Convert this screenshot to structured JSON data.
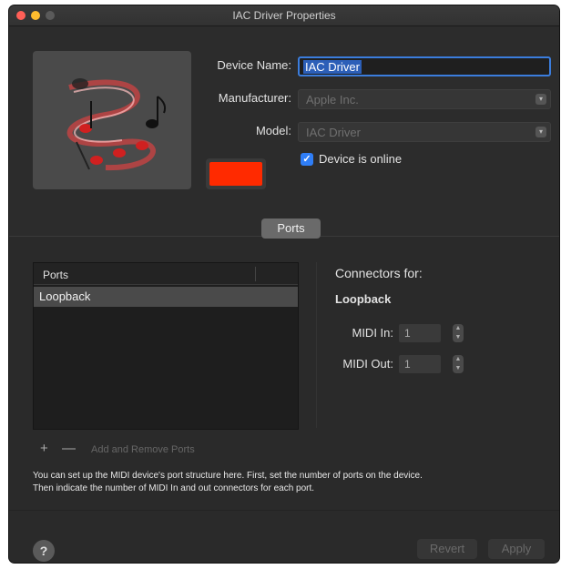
{
  "window": {
    "title": "IAC Driver Properties"
  },
  "device": {
    "name_label": "Device Name:",
    "name_value": "IAC Driver",
    "manufacturer_label": "Manufacturer:",
    "manufacturer_placeholder": "Apple Inc.",
    "model_label": "Model:",
    "model_placeholder": "IAC Driver",
    "online_label": "Device is online",
    "online_checked": true,
    "color": "#ff2a00",
    "icon": "music-notes-icon"
  },
  "tabs": {
    "ports_label": "Ports"
  },
  "ports": {
    "header": "Ports",
    "items": [
      {
        "label": "Loopback",
        "selected": true
      }
    ],
    "add_remove_label": "Add and Remove Ports"
  },
  "connectors": {
    "title": "Connectors for:",
    "port_name": "Loopback",
    "midi_in_label": "MIDI In:",
    "midi_in_value": "1",
    "midi_out_label": "MIDI Out:",
    "midi_out_value": "1"
  },
  "help": {
    "line1": "You can set up the MIDI device's port structure here. First, set the number of ports on the device.",
    "line2": "Then indicate the number of MIDI In and out connectors for each port."
  },
  "footer": {
    "revert_label": "Revert",
    "apply_label": "Apply",
    "help_symbol": "?"
  },
  "colors": {
    "accent": "#3b7ddd",
    "checkbox": "#2f7ef7",
    "window_bg": "#2a2a2a"
  }
}
